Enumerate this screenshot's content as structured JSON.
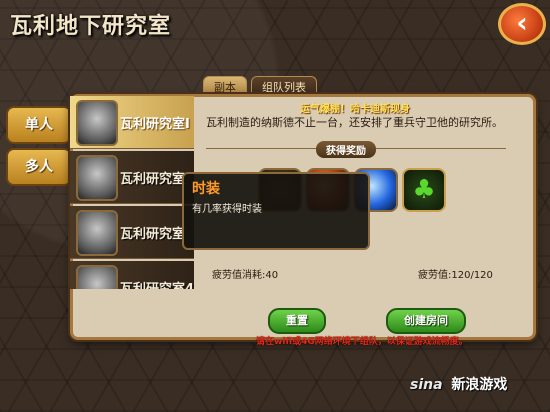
{
  "header": {
    "title": "瓦利地下研究室",
    "back_icon": "chevron-left-icon"
  },
  "tabs": [
    "副本",
    "组队列表"
  ],
  "side_tabs": [
    "单人",
    "多人"
  ],
  "dungeons": [
    {
      "label": "瓦利研究室I",
      "icon": "robot-avatar"
    },
    {
      "label": "瓦利研究室",
      "icon": "robot-avatar"
    },
    {
      "label": "瓦利研究室",
      "icon": "robot-avatar"
    },
    {
      "label": "瓦利研究室4",
      "icon": "robot-avatar"
    }
  ],
  "detail": {
    "lucky_text": "运气爆棚！哈卡迪斯现身",
    "description": "瓦利制造的纳斯德不止一台，还安排了重兵守卫他的研究所。",
    "reward_title": "获得奖励",
    "fatigue_cost": "疲劳值消耗:40",
    "fatigue_total": "疲劳值:120/120"
  },
  "tooltip": {
    "title": "时装",
    "text": "有几率获得时装"
  },
  "buttons": {
    "reset": "重置",
    "create_room": "创建房间"
  },
  "notice": "请在wifi或4G网络环境下组队，以保证游戏流畅度。",
  "watermark": {
    "logo": "sina",
    "text": "新浪游戏"
  },
  "colors": {
    "accent": "#e7b850",
    "button_green": "#2d8a1a",
    "warning_red": "#e5281a"
  }
}
